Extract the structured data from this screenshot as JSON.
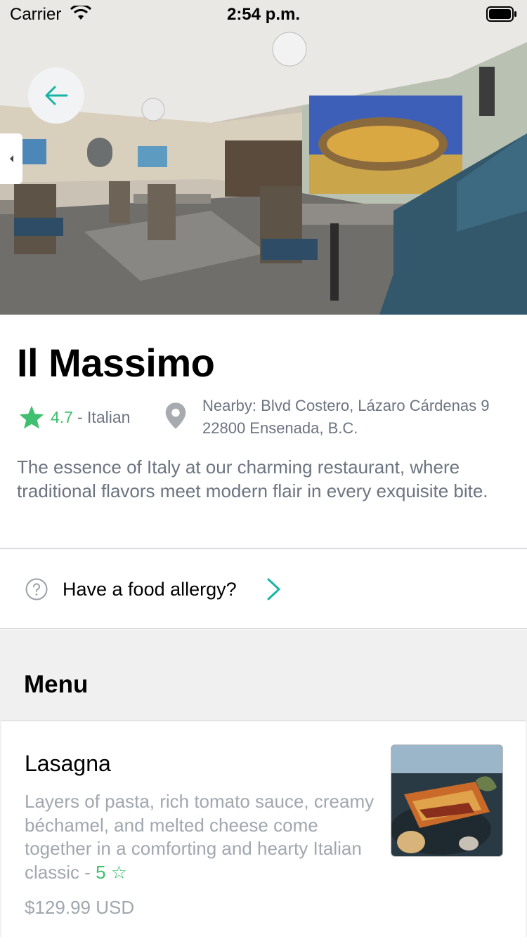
{
  "status_bar": {
    "carrier": "Carrier",
    "time": "2:54 p.m."
  },
  "hero": {
    "image": "restaurant-interior-photo"
  },
  "restaurant": {
    "name": "Il Massimo",
    "rating": "4.7",
    "cuisine": "- Italian",
    "address_line1": "Nearby: Blvd Costero, Lázaro Cárdenas 9",
    "address_line2": "22800 Ensenada, B.C.",
    "description": "The essence of Italy at our charming restaurant, where traditional flavors meet modern flair in every exquisite bite."
  },
  "allergy": {
    "label": "Have a food allergy?"
  },
  "menu": {
    "title": "Menu",
    "items": [
      {
        "name": "Lasagna",
        "description": "Layers of pasta, rich tomato sauce, creamy béchamel, and melted cheese come together in a comforting and hearty Italian classic - ",
        "rating": "5 ☆",
        "price": "$129.99 USD"
      }
    ]
  },
  "colors": {
    "accent": "#18b5a4",
    "rating_green": "#3fbf6f",
    "muted_text": "#6b7480",
    "section_bg": "#f0f0f0"
  },
  "icons": [
    "wifi-icon",
    "battery-icon",
    "arrow-left-icon",
    "chevron-left-icon",
    "star-icon",
    "location-pin-icon",
    "question-circle-icon",
    "chevron-right-icon"
  ]
}
